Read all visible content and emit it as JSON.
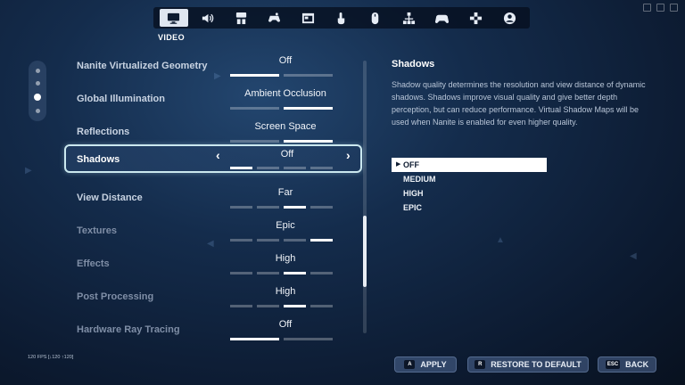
{
  "nav": {
    "tabs": [
      {
        "icon": "monitor-icon",
        "active": true
      },
      {
        "icon": "speaker-icon",
        "active": false
      },
      {
        "icon": "controller-layout-icon",
        "active": false
      },
      {
        "icon": "gamepad-touch-icon",
        "active": false
      },
      {
        "icon": "window-icon",
        "active": false
      },
      {
        "icon": "touch-icon",
        "active": false
      },
      {
        "icon": "mouse-icon",
        "active": false
      },
      {
        "icon": "network-icon",
        "active": false
      },
      {
        "icon": "controller-icon",
        "active": false
      },
      {
        "icon": "dpad-icon",
        "active": false
      },
      {
        "icon": "account-icon",
        "active": false
      }
    ],
    "active_label": "VIDEO"
  },
  "pager": {
    "count": 4,
    "active_index": 2
  },
  "settings": [
    {
      "label": "Nanite Virtualized Geometry",
      "value": "Off",
      "segments": 2,
      "active_segment": 0,
      "state": "normal"
    },
    {
      "label": "Global Illumination",
      "value": "Ambient Occlusion",
      "segments": 2,
      "active_segment": 1,
      "state": "normal"
    },
    {
      "label": "Reflections",
      "value": "Screen Space",
      "segments": 2,
      "active_segment": 1,
      "state": "normal"
    },
    {
      "label": "Shadows",
      "value": "Off",
      "segments": 4,
      "active_segment": 0,
      "state": "selected"
    },
    {
      "label": "View Distance",
      "value": "Far",
      "segments": 4,
      "active_segment": 2,
      "state": "normal"
    },
    {
      "label": "Textures",
      "value": "Epic",
      "segments": 4,
      "active_segment": 3,
      "state": "dim"
    },
    {
      "label": "Effects",
      "value": "High",
      "segments": 4,
      "active_segment": 2,
      "state": "dim"
    },
    {
      "label": "Post Processing",
      "value": "High",
      "segments": 4,
      "active_segment": 2,
      "state": "dim"
    },
    {
      "label": "Hardware Ray Tracing",
      "value": "Off",
      "segments": 2,
      "active_segment": 0,
      "state": "dim"
    }
  ],
  "scroll": {
    "position_fraction": 0.57,
    "visible_fraction": 0.26
  },
  "detail": {
    "title": "Shadows",
    "description": "Shadow quality determines the resolution and view distance of dynamic shadows. Shadows improve visual quality and give better depth perception, but can reduce performance. Virtual Shadow Maps will be used when Nanite is enabled for even higher quality.",
    "options": [
      "OFF",
      "MEDIUM",
      "HIGH",
      "EPIC"
    ],
    "selected_option": 0
  },
  "fps_text": "120 FPS [↓120 ↑120]",
  "buttons": {
    "apply": {
      "key": "A",
      "label": "APPLY"
    },
    "restore": {
      "key": "R",
      "label": "RESTORE TO DEFAULT"
    },
    "back": {
      "key": "ESC",
      "label": "BACK"
    }
  },
  "colors": {
    "accent_border": "#cbe8ef",
    "button_bg": "#50699a",
    "selected_option_bg": "#ffffff"
  }
}
